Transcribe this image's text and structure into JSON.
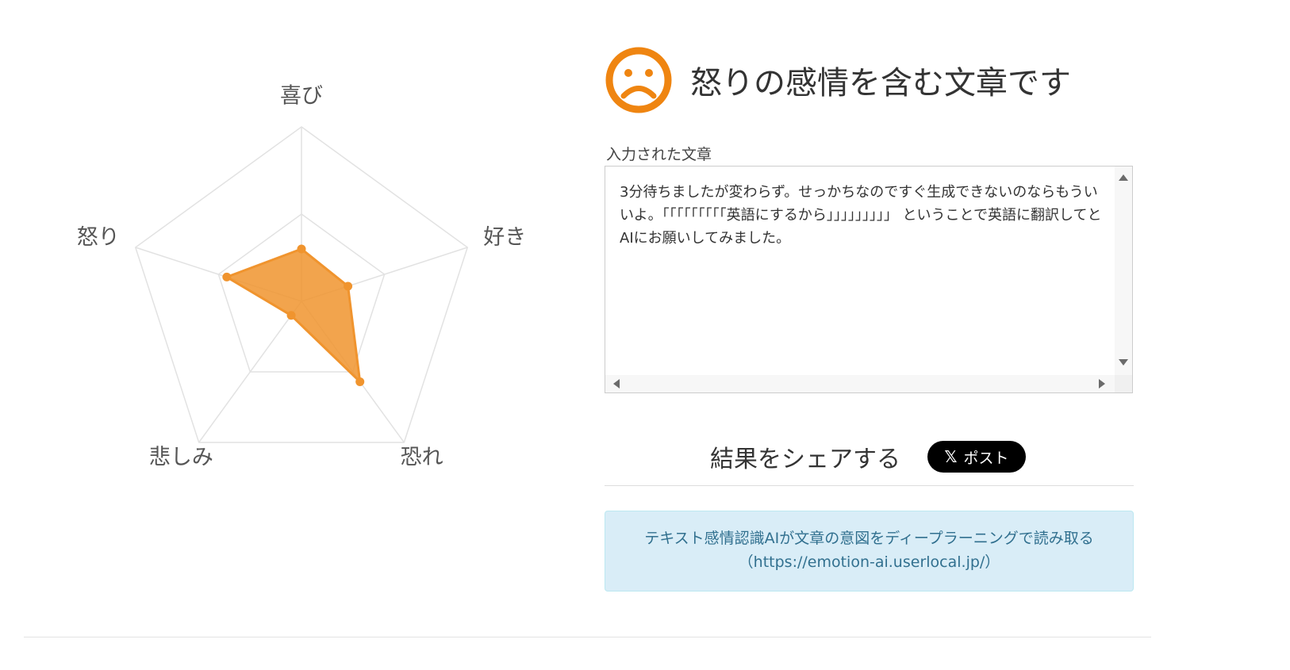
{
  "chart_data": {
    "type": "radar",
    "axes": [
      "喜び",
      "好き",
      "恐れ",
      "悲しみ",
      "怒り"
    ],
    "max": 1.0,
    "levels": 2,
    "values": [
      0.3,
      0.28,
      0.57,
      0.1,
      0.45
    ],
    "color": "#f0942e",
    "fill_opacity": 0.85
  },
  "result": {
    "title": "怒りの感情を含む文章です",
    "icon": "frown-face-icon",
    "icon_color": "#ef8511"
  },
  "input": {
    "label": "入力された文章",
    "text": "3分待ちましたが変わらず。せっかちなのですぐ生成できないのならもういいよ。「「「「「「「「「英語にするから」」」」」」」」」 ということで英語に翻訳してとAIにお願いしてみました。"
  },
  "share": {
    "label": "結果をシェアする",
    "button_icon": "𝕏",
    "button_label": "ポスト"
  },
  "info": {
    "line1": "テキスト感情認識AIが文章の意図をディープラーニングで読み取る",
    "line2": "（https://emotion-ai.userlocal.jp/）",
    "bg_color": "#d9edf7",
    "text_color": "#31708f"
  }
}
